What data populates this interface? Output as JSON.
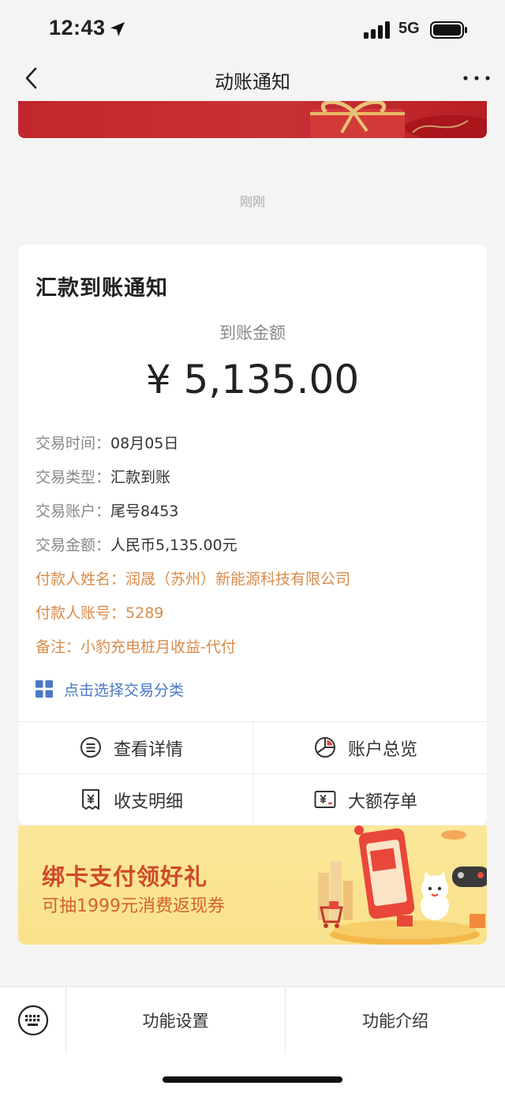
{
  "status_bar": {
    "time": "12:43",
    "network": "5G"
  },
  "nav": {
    "title": "动账通知"
  },
  "timestamp": "刚刚",
  "card": {
    "title": "汇款到账通知",
    "amount_label": "到账金额",
    "amount": "¥ 5,135.00",
    "details": [
      {
        "label": "交易时间：",
        "value": "08月05日"
      },
      {
        "label": "交易类型：",
        "value": "汇款到账"
      },
      {
        "label": "交易账户：",
        "value": "尾号8453"
      },
      {
        "label": "交易金额：",
        "value": "人民币5,135.00元"
      },
      {
        "label": "付款人姓名：",
        "value": "润晟（苏州）新能源科技有限公司"
      },
      {
        "label": "付款人账号：",
        "value": "5289"
      },
      {
        "label": "备注：",
        "value": "小豹充电桩月收益-代付"
      }
    ],
    "category_link": "点击选择交易分类",
    "actions": {
      "view_details": "查看详情",
      "account_overview": "账户总览",
      "statement": "收支明细",
      "large_deposit": "大额存单"
    }
  },
  "promo": {
    "title": "绑卡支付领好礼",
    "subtitle": "可抽1999元消费返现券"
  },
  "bottom_bar": {
    "tab_settings": "功能设置",
    "tab_intro": "功能介绍"
  },
  "colors": {
    "accent_orange": "#d88b4a",
    "link_blue": "#4a78c2",
    "banner_red": "#c1272d",
    "promo_yellow": "#fbe79a"
  }
}
